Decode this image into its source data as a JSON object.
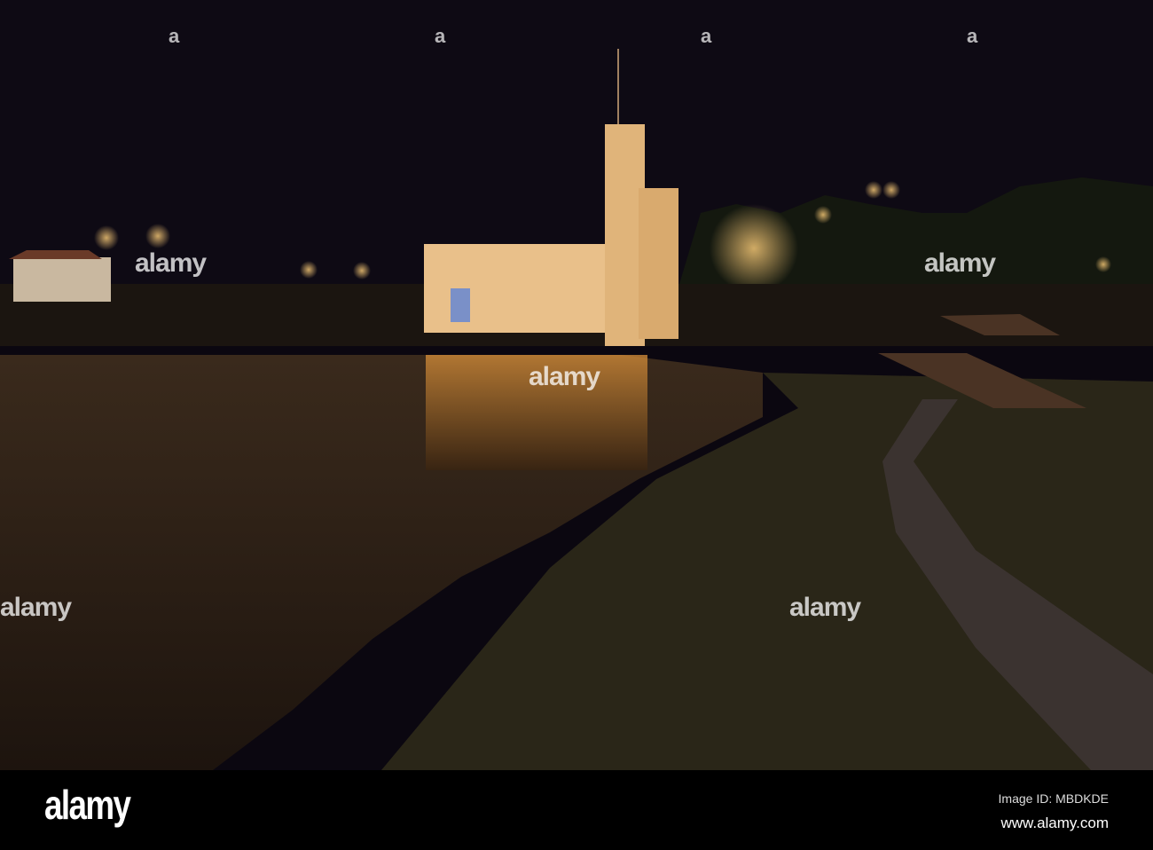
{
  "photo": {
    "subject": "Illuminated hydroelectric power station with tower reflected in river at night"
  },
  "watermark": {
    "text": "alamy"
  },
  "footer": {
    "logo": "alamy",
    "image_id": "Image ID: MBDKDE",
    "url": "www.alamy.com"
  }
}
